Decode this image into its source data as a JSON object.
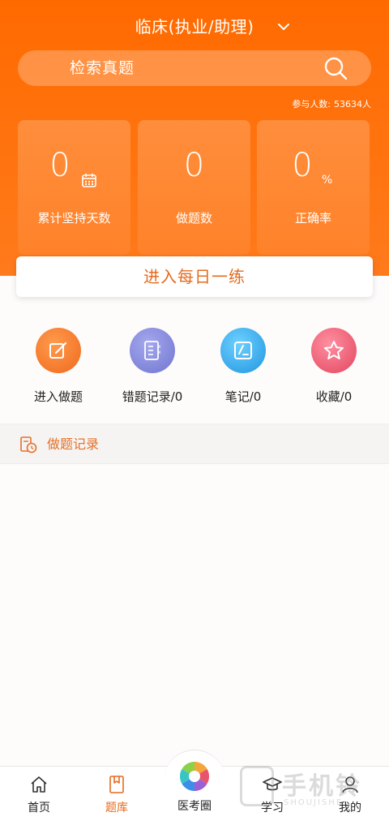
{
  "header": {
    "title": "临床(执业/助理)",
    "dropdown_icon": "chevron-down-icon"
  },
  "search": {
    "placeholder": "检索真题",
    "icon": "search-icon"
  },
  "participants": {
    "label": "参与人数:",
    "count": "53634人"
  },
  "stats": [
    {
      "value": "0",
      "label": "累计坚持天数",
      "icon": "calendar-icon"
    },
    {
      "value": "0",
      "label": "做题数"
    },
    {
      "value": "0",
      "unit": "%",
      "label": "正确率"
    }
  ],
  "daily_practice": {
    "label": "进入每日一练"
  },
  "quick_actions": [
    {
      "label": "进入做题",
      "icon": "edit-icon",
      "color": "#f0742c"
    },
    {
      "label": "错题记录/0",
      "icon": "wrong-list-icon",
      "color": "#7e82d6"
    },
    {
      "label": "笔记/0",
      "icon": "note-icon",
      "color": "#2fa3e6"
    },
    {
      "label": "收藏/0",
      "icon": "star-icon",
      "color": "#e9506a"
    }
  ],
  "record_section": {
    "label": "做题记录",
    "icon": "history-clock-icon"
  },
  "tabbar": {
    "items": [
      {
        "label": "首页",
        "icon": "home-icon"
      },
      {
        "label": "题库",
        "icon": "question-bank-icon",
        "active": true
      },
      {
        "label": "医考圈",
        "icon": "community-logo-icon"
      },
      {
        "label": "学习",
        "icon": "graduation-cap-icon"
      },
      {
        "label": "我的",
        "icon": "profile-icon"
      }
    ],
    "active_color": "#e46b1e"
  },
  "watermark": {
    "text": "手机铃",
    "sub": "SHOUJISHE"
  },
  "colors": {
    "brand": "#ff6a00",
    "accent_text": "#e46b1e"
  }
}
